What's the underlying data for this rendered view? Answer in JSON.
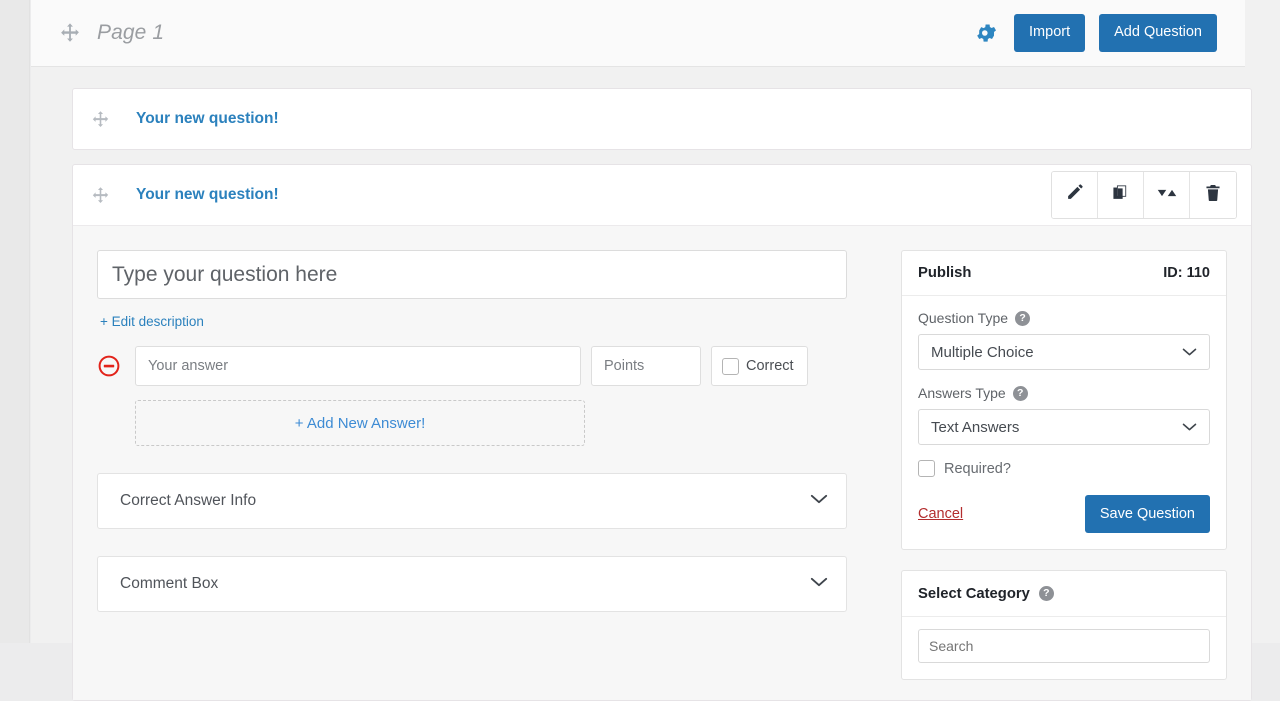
{
  "header": {
    "page_label": "Page 1",
    "move_icon": "move-arrows-icon",
    "gear_icon": "gear-icon",
    "import_label": "Import",
    "add_question_label": "Add Question"
  },
  "questions": [
    {
      "title": "Your new question!",
      "move_icon": "move-arrows-icon"
    },
    {
      "title": "Your new question!",
      "move_icon": "move-arrows-icon"
    }
  ],
  "question_actions": [
    {
      "name": "edit-question-button",
      "icon": "pencil-icon"
    },
    {
      "name": "duplicate-question-button",
      "icon": "copy-icon"
    },
    {
      "name": "sort-question-button",
      "icon": "sort-icon"
    },
    {
      "name": "delete-question-button",
      "icon": "trash-icon"
    }
  ],
  "editor": {
    "question_placeholder": "Type your question here",
    "question_value": "",
    "edit_description_label": "+ Edit description",
    "answer": {
      "remove_icon": "minus-circle-icon",
      "answer_placeholder": "Your answer",
      "answer_value": "",
      "points_placeholder": "Points",
      "points_value": "",
      "correct_label": "Correct",
      "correct_checked": false
    },
    "add_new_answer_label": "+ Add New Answer!",
    "accordions": [
      {
        "label": "Correct Answer Info",
        "chevron": "chevron-down-icon"
      },
      {
        "label": "Comment Box",
        "chevron": "chevron-down-icon"
      }
    ]
  },
  "publish_panel": {
    "title": "Publish",
    "id_label": "ID: 110",
    "question_type_label": "Question Type",
    "question_type_value": "Multiple Choice",
    "answers_type_label": "Answers Type",
    "answers_type_value": "Text Answers",
    "required_label": "Required?",
    "required_checked": false,
    "cancel_label": "Cancel",
    "save_label": "Save Question",
    "help_glyph": "?"
  },
  "category_panel": {
    "title": "Select Category",
    "search_placeholder": "Search",
    "help_glyph": "?"
  },
  "colors": {
    "accent_blue": "#2271b1",
    "link_blue": "#2b81bd",
    "danger_red": "#b32d2e",
    "gear_blue": "#2e86c1",
    "page_bg": "#f1f1f1"
  }
}
